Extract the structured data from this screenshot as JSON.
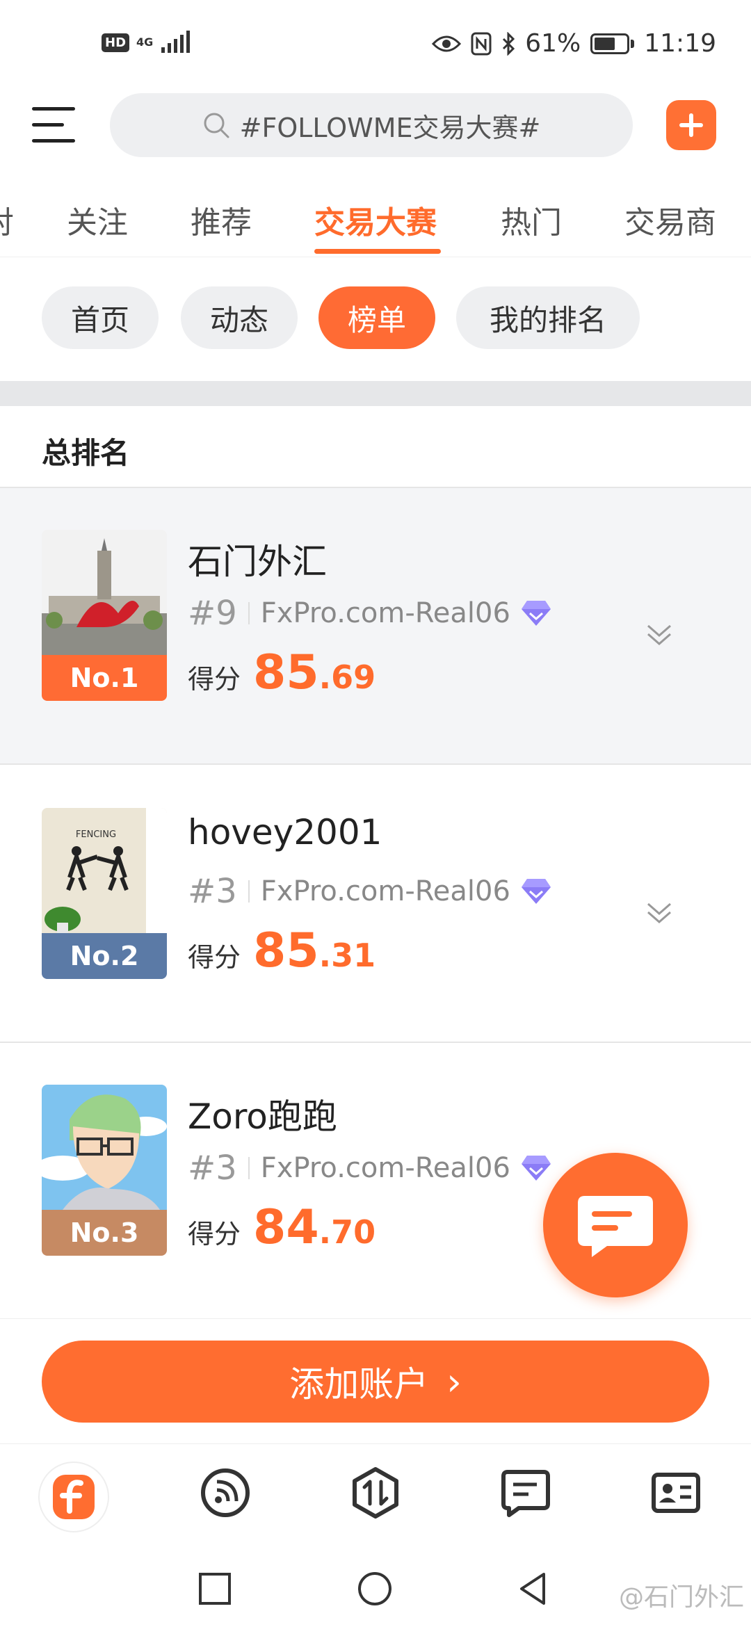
{
  "status_bar": {
    "hd": "HD",
    "network": "4G",
    "battery": "61%",
    "time": "11:19"
  },
  "search": {
    "placeholder": "#FOLLOWME交易大赛#"
  },
  "tabs": [
    {
      "label": "对"
    },
    {
      "label": "关注"
    },
    {
      "label": "推荐"
    },
    {
      "label": "交易大赛",
      "active": true
    },
    {
      "label": "热门"
    },
    {
      "label": "交易商"
    }
  ],
  "chips": [
    {
      "label": "首页"
    },
    {
      "label": "动态"
    },
    {
      "label": "榜单",
      "active": true
    },
    {
      "label": "我的排名"
    }
  ],
  "section_title": "总排名",
  "rankings": [
    {
      "badge": "No.1",
      "name": "石门外汇",
      "rank": "#9",
      "broker": "FxPro.com-Real06",
      "score_label": "得分",
      "score_int": "85",
      "score_dec": ".69"
    },
    {
      "badge": "No.2",
      "name": "hovey2001",
      "rank": "#3",
      "broker": "FxPro.com-Real06",
      "score_label": "得分",
      "score_int": "85",
      "score_dec": ".31"
    },
    {
      "badge": "No.3",
      "name": "Zoro跑跑",
      "rank": "#3",
      "broker": "FxPro.com-Real06",
      "score_label": "得分",
      "score_int": "84",
      "score_dec": ".70"
    }
  ],
  "avatar_image_text": "FENCING",
  "add_account": {
    "label": "添加账户",
    "arrow": "›"
  },
  "watermark": "@石门外汇",
  "colors": {
    "accent": "#ff6b2c",
    "gold": "#ff6b34",
    "silver": "#5b7aa6",
    "bronze": "#c68a63",
    "diamond": "#8b7cf6"
  },
  "icons": {
    "menu": "hamburger-icon",
    "search": "search-icon",
    "add": "plus-icon",
    "expand": "chevron-double-down-icon",
    "chat": "chat-bubble-icon",
    "nav": [
      "followme-logo-icon",
      "feed-icon",
      "trade-icon",
      "message-icon",
      "profile-card-icon"
    ]
  }
}
